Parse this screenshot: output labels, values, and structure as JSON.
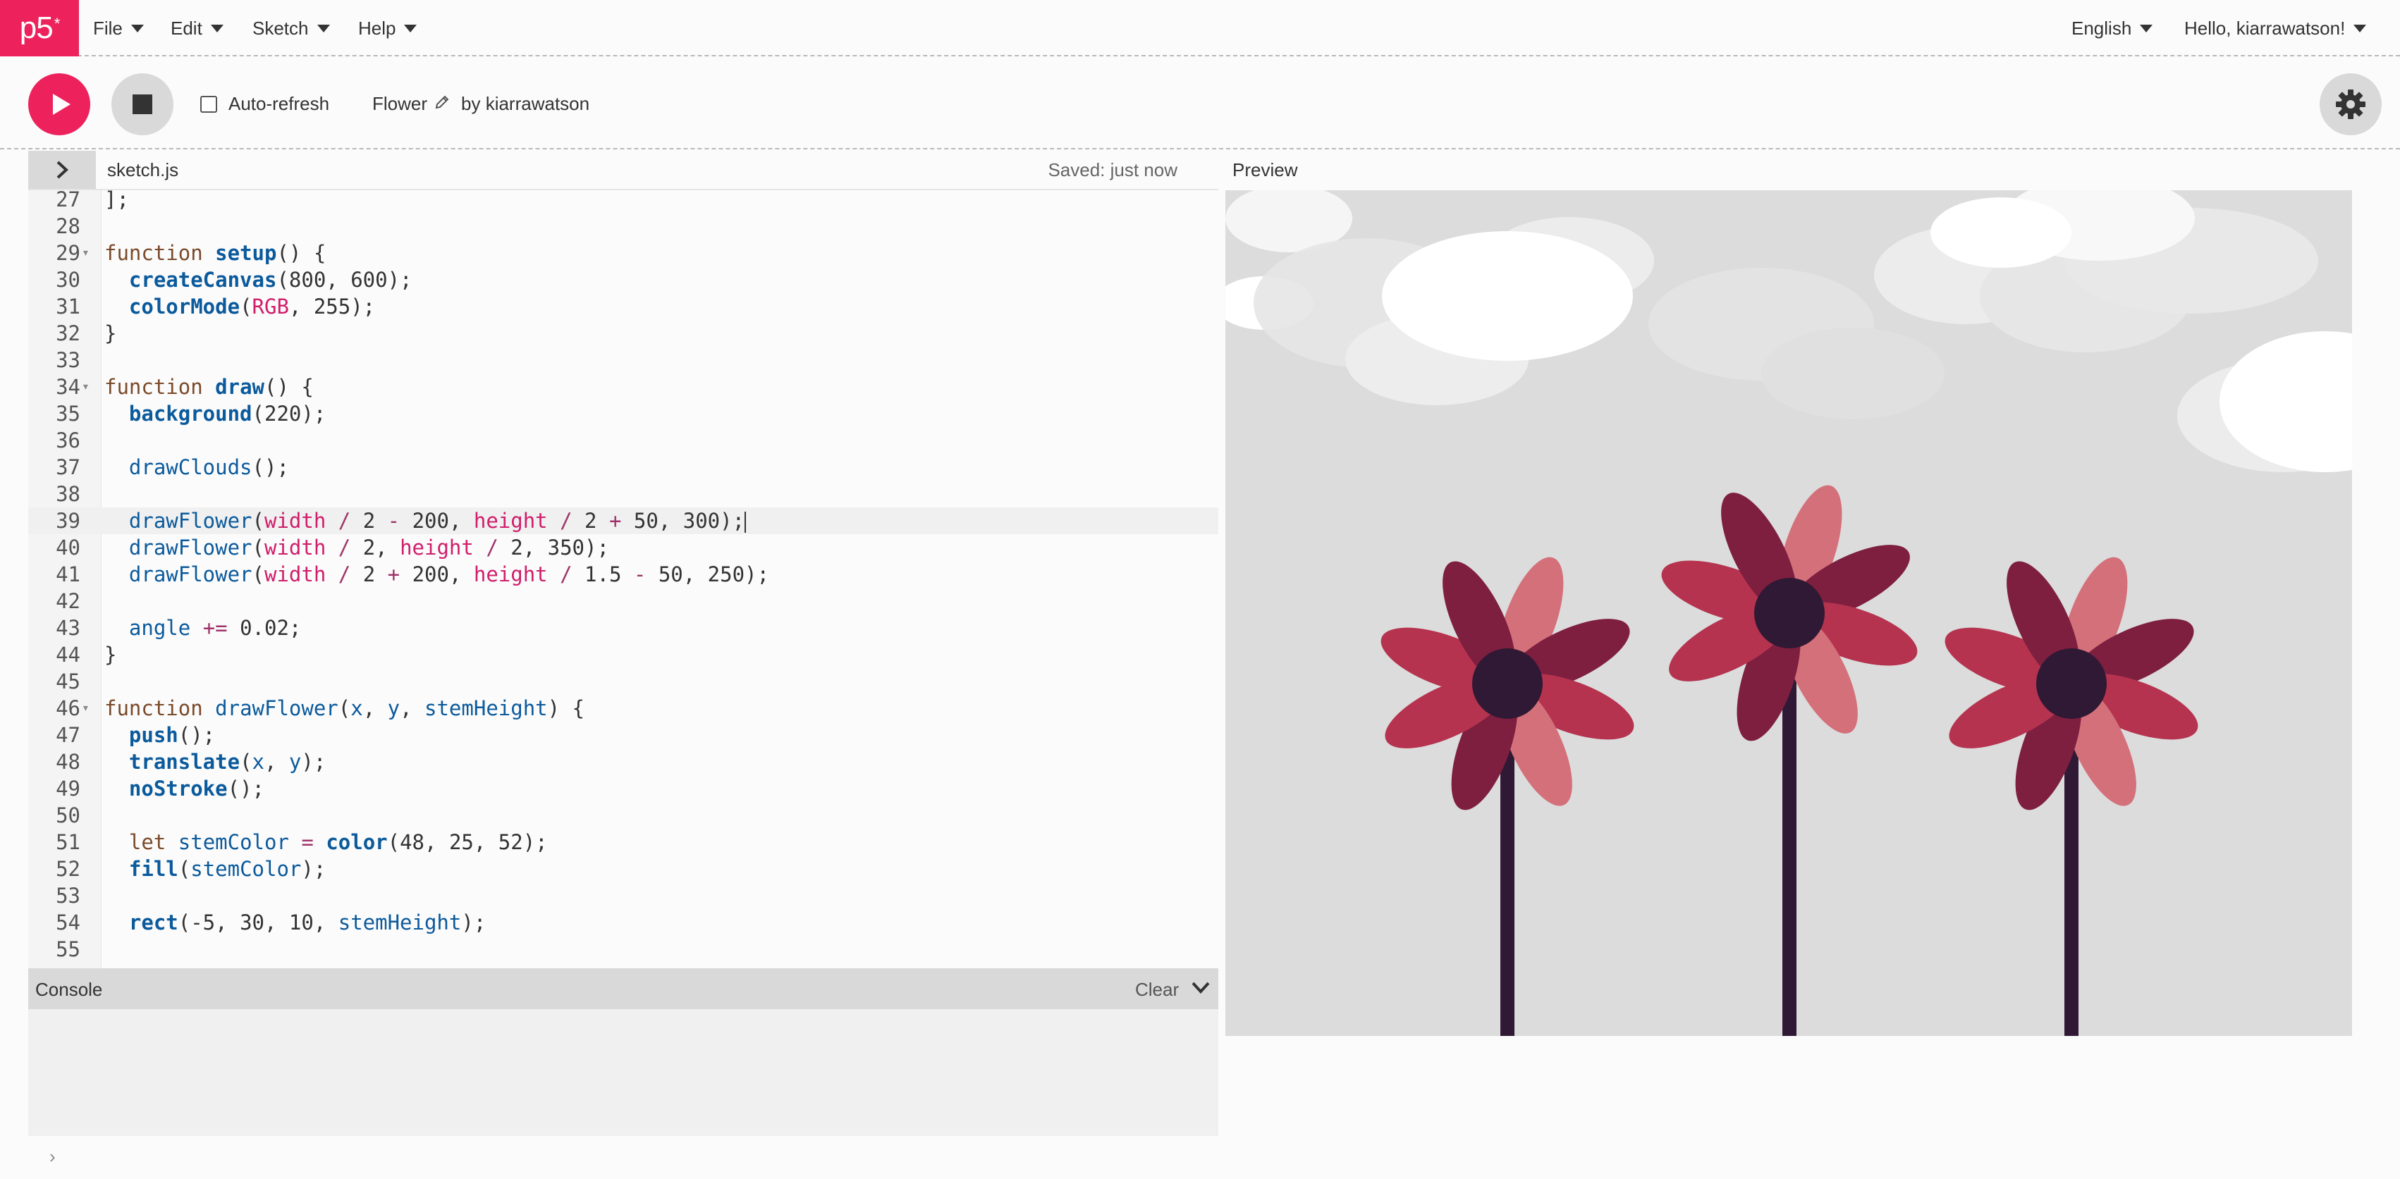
{
  "nav": {
    "logo": "p5",
    "logo_star": "*",
    "menus": [
      "File",
      "Edit",
      "Sketch",
      "Help"
    ],
    "language": "English",
    "greeting": "Hello, kiarrawatson!"
  },
  "toolbar": {
    "auto_refresh_label": "Auto-refresh",
    "auto_refresh_checked": false,
    "sketch_name": "Flower",
    "by_label": "by kiarrawatson"
  },
  "editor": {
    "file_name": "sketch.js",
    "saved_status": "Saved: just now",
    "lines": [
      {
        "n": "27",
        "code": "];"
      },
      {
        "n": "28",
        "code": ""
      },
      {
        "n": "29",
        "code": "function setup() {",
        "fold": true
      },
      {
        "n": "30",
        "code": "  createCanvas(800, 600);"
      },
      {
        "n": "31",
        "code": "  colorMode(RGB, 255);"
      },
      {
        "n": "32",
        "code": "}"
      },
      {
        "n": "33",
        "code": ""
      },
      {
        "n": "34",
        "code": "function draw() {",
        "fold": true
      },
      {
        "n": "35",
        "code": "  background(220);"
      },
      {
        "n": "36",
        "code": ""
      },
      {
        "n": "37",
        "code": "  drawClouds();"
      },
      {
        "n": "38",
        "code": ""
      },
      {
        "n": "39",
        "code": "  drawFlower(width / 2 - 200, height / 2 + 50, 300);",
        "active": true
      },
      {
        "n": "40",
        "code": "  drawFlower(width / 2, height / 2, 350);"
      },
      {
        "n": "41",
        "code": "  drawFlower(width / 2 + 200, height / 1.5 - 50, 250);"
      },
      {
        "n": "42",
        "code": ""
      },
      {
        "n": "43",
        "code": "  angle += 0.02;"
      },
      {
        "n": "44",
        "code": "}"
      },
      {
        "n": "45",
        "code": ""
      },
      {
        "n": "46",
        "code": "function drawFlower(x, y, stemHeight) {",
        "fold": true
      },
      {
        "n": "47",
        "code": "  push();"
      },
      {
        "n": "48",
        "code": "  translate(x, y);"
      },
      {
        "n": "49",
        "code": "  noStroke();"
      },
      {
        "n": "50",
        "code": ""
      },
      {
        "n": "51",
        "code": "  let stemColor = color(48, 25, 52);"
      },
      {
        "n": "52",
        "code": "  fill(stemColor);"
      },
      {
        "n": "53",
        "code": ""
      },
      {
        "n": "54",
        "code": "  rect(-5, 30, 10, stemHeight);"
      },
      {
        "n": "55",
        "code": ""
      }
    ]
  },
  "preview": {
    "label": "Preview",
    "background_color": "#dcdcdc",
    "stem_color": "#301934",
    "petal_colors": [
      "#b5334f",
      "#7e1f40",
      "#d4707a"
    ]
  },
  "console": {
    "title": "Console",
    "clear_label": "Clear",
    "prompt": "›"
  },
  "colors": {
    "accent": "#ed225d"
  }
}
